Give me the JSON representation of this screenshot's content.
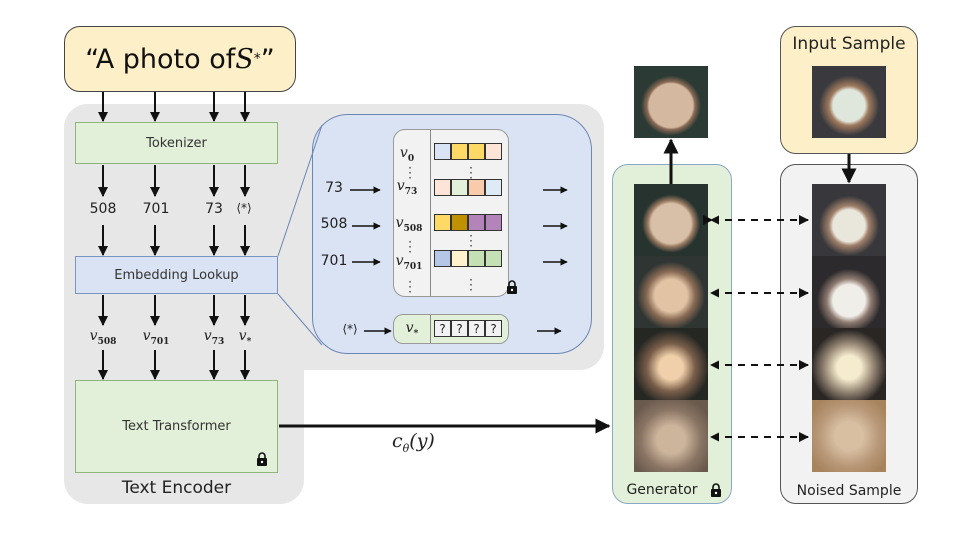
{
  "prompt": {
    "text_prefix": "“A photo of ",
    "token": "S",
    "token_sub": "*",
    "text_suffix": "”"
  },
  "text_encoder": {
    "label": "Text Encoder",
    "tokenizer_label": "Tokenizer",
    "embedding_lookup_label": "Embedding Lookup",
    "text_transformer_label": "Text Transformer",
    "token_ids": [
      "508",
      "701",
      "73",
      "⟨*⟩"
    ],
    "embedding_vectors": [
      {
        "base": "v",
        "sub": "508"
      },
      {
        "base": "v",
        "sub": "701"
      },
      {
        "base": "v",
        "sub": "73"
      },
      {
        "base": "v",
        "sub": "*"
      }
    ]
  },
  "embedding_table": {
    "rows": [
      {
        "input": "",
        "base": "v",
        "sub": "0",
        "colors": [
          "#dae3f3",
          "#ffd966",
          "#ffd966",
          "#fce4d6"
        ]
      },
      {
        "input": "73",
        "base": "v",
        "sub": "73",
        "colors": [
          "#fce4d6",
          "#e2efd9",
          "#f8cbad",
          "#deebf7"
        ]
      },
      {
        "input": "508",
        "base": "v",
        "sub": "508",
        "colors": [
          "#ffd966",
          "#bf9000",
          "#b384b9",
          "#b384b9"
        ]
      },
      {
        "input": "701",
        "base": "v",
        "sub": "701",
        "colors": [
          "#b4c7e7",
          "#fff2cc",
          "#c5e0b4",
          "#c5e0b4"
        ]
      }
    ],
    "learned": {
      "input": "⟨*⟩",
      "base": "v",
      "sub": "*",
      "cells": [
        "?",
        "?",
        "?",
        "?"
      ]
    }
  },
  "conditioning": {
    "label_base": "c",
    "label_sub": "θ",
    "label_arg": "(y)"
  },
  "generator": {
    "label": "Generator"
  },
  "input_sample": {
    "label": "Input Sample"
  },
  "noised_sample": {
    "label": "Noised Sample"
  }
}
